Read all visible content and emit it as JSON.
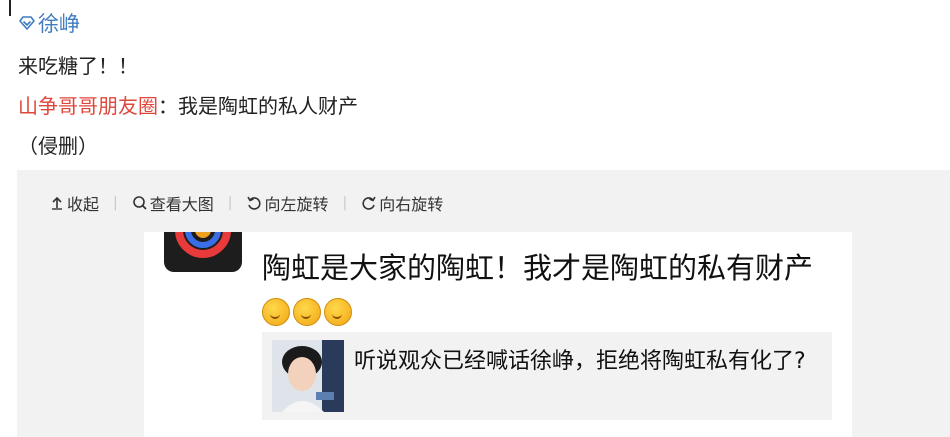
{
  "post": {
    "author": "徐峥",
    "line1": "来吃糖了！！",
    "mention": "山争哥哥朋友圈",
    "mention_rest": "：我是陶虹的私人财产",
    "line3": "（侵删）"
  },
  "toolbar": {
    "collapse": "收起",
    "view_large": "查看大图",
    "rotate_left": "向左旋转",
    "rotate_right": "向右旋转"
  },
  "image": {
    "post_text": "陶虹是大家的陶虹！我才是陶虹的私有财产",
    "quote_text": "听说观众已经喊话徐峥，拒绝将陶虹私有化了?",
    "emoji_count": 3
  },
  "colors": {
    "link_blue": "#3f7cc0",
    "mention_red": "#e0473b",
    "media_bg": "#f2f2f2"
  }
}
